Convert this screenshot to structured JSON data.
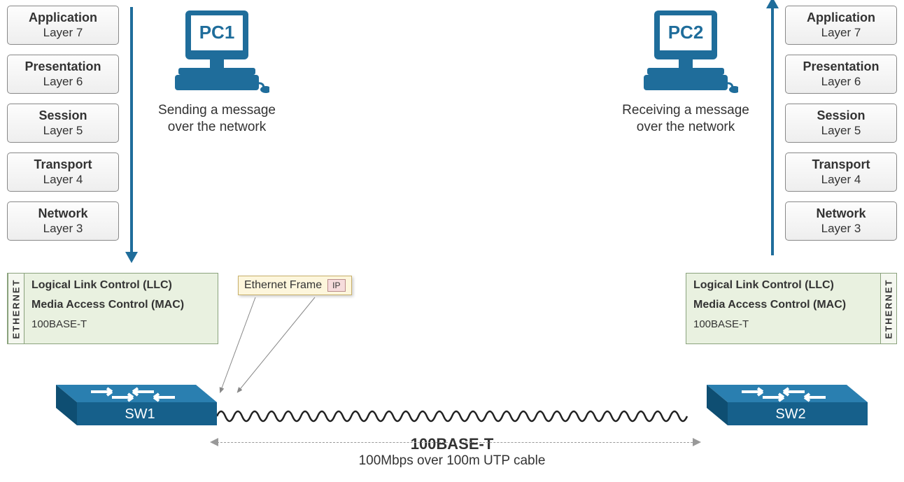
{
  "osi": [
    {
      "t": "Application",
      "s": "Layer 7"
    },
    {
      "t": "Presentation",
      "s": "Layer 6"
    },
    {
      "t": "Session",
      "s": "Layer 5"
    },
    {
      "t": "Transport",
      "s": "Layer 4"
    },
    {
      "t": "Network",
      "s": "Layer 3"
    }
  ],
  "eth": {
    "tab": "ETHERNET",
    "llc": "Logical Link Control (LLC)",
    "mac": "Media Access Control (MAC)",
    "phy": "100BASE-T"
  },
  "pc1": {
    "name": "PC1",
    "cap1": "Sending a message",
    "cap2": "over the network"
  },
  "pc2": {
    "name": "PC2",
    "cap1": "Receiving a message",
    "cap2": "over the network"
  },
  "frame": {
    "label": "Ethernet Frame",
    "chip": "IP"
  },
  "sw1": "SW1",
  "sw2": "SW2",
  "link": {
    "title": "100BASE-T",
    "sub": "100Mbps over 100m UTP cable"
  },
  "colors": {
    "cisco": "#1f6d9b"
  }
}
